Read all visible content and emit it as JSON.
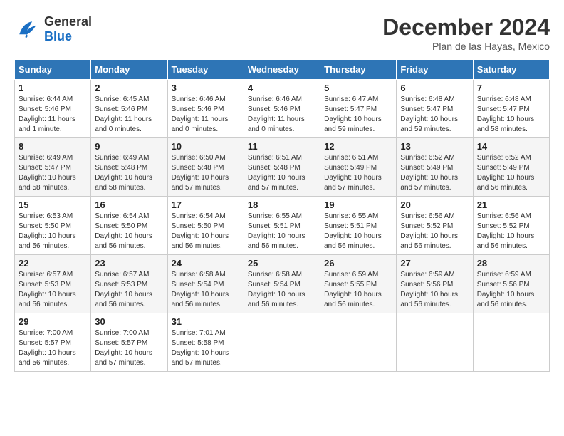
{
  "header": {
    "logo_line1": "General",
    "logo_line2": "Blue",
    "month": "December 2024",
    "location": "Plan de las Hayas, Mexico"
  },
  "calendar": {
    "weekdays": [
      "Sunday",
      "Monday",
      "Tuesday",
      "Wednesday",
      "Thursday",
      "Friday",
      "Saturday"
    ],
    "weeks": [
      [
        null,
        {
          "day": "2",
          "sunrise": "6:45 AM",
          "sunset": "5:46 PM",
          "daylight": "11 hours and 0 minutes."
        },
        {
          "day": "3",
          "sunrise": "6:46 AM",
          "sunset": "5:46 PM",
          "daylight": "11 hours and 0 minutes."
        },
        {
          "day": "4",
          "sunrise": "6:46 AM",
          "sunset": "5:46 PM",
          "daylight": "11 hours and 0 minutes."
        },
        {
          "day": "5",
          "sunrise": "6:47 AM",
          "sunset": "5:47 PM",
          "daylight": "10 hours and 59 minutes."
        },
        {
          "day": "6",
          "sunrise": "6:48 AM",
          "sunset": "5:47 PM",
          "daylight": "10 hours and 59 minutes."
        },
        {
          "day": "7",
          "sunrise": "6:48 AM",
          "sunset": "5:47 PM",
          "daylight": "10 hours and 58 minutes."
        }
      ],
      [
        {
          "day": "1",
          "sunrise": "6:44 AM",
          "sunset": "5:46 PM",
          "daylight": "11 hours and 1 minute."
        },
        {
          "day": "8",
          "sunrise": "6:49 AM",
          "sunset": "5:47 PM",
          "daylight": "10 hours and 58 minutes."
        },
        null,
        null,
        null,
        null,
        null
      ],
      [
        {
          "day": "8",
          "sunrise": "6:49 AM",
          "sunset": "5:47 PM",
          "daylight": "10 hours and 58 minutes."
        },
        {
          "day": "9",
          "sunrise": "6:49 AM",
          "sunset": "5:48 PM",
          "daylight": "10 hours and 58 minutes."
        },
        {
          "day": "10",
          "sunrise": "6:50 AM",
          "sunset": "5:48 PM",
          "daylight": "10 hours and 57 minutes."
        },
        {
          "day": "11",
          "sunrise": "6:51 AM",
          "sunset": "5:48 PM",
          "daylight": "10 hours and 57 minutes."
        },
        {
          "day": "12",
          "sunrise": "6:51 AM",
          "sunset": "5:49 PM",
          "daylight": "10 hours and 57 minutes."
        },
        {
          "day": "13",
          "sunrise": "6:52 AM",
          "sunset": "5:49 PM",
          "daylight": "10 hours and 57 minutes."
        },
        {
          "day": "14",
          "sunrise": "6:52 AM",
          "sunset": "5:49 PM",
          "daylight": "10 hours and 56 minutes."
        }
      ],
      [
        {
          "day": "15",
          "sunrise": "6:53 AM",
          "sunset": "5:50 PM",
          "daylight": "10 hours and 56 minutes."
        },
        {
          "day": "16",
          "sunrise": "6:54 AM",
          "sunset": "5:50 PM",
          "daylight": "10 hours and 56 minutes."
        },
        {
          "day": "17",
          "sunrise": "6:54 AM",
          "sunset": "5:50 PM",
          "daylight": "10 hours and 56 minutes."
        },
        {
          "day": "18",
          "sunrise": "6:55 AM",
          "sunset": "5:51 PM",
          "daylight": "10 hours and 56 minutes."
        },
        {
          "day": "19",
          "sunrise": "6:55 AM",
          "sunset": "5:51 PM",
          "daylight": "10 hours and 56 minutes."
        },
        {
          "day": "20",
          "sunrise": "6:56 AM",
          "sunset": "5:52 PM",
          "daylight": "10 hours and 56 minutes."
        },
        {
          "day": "21",
          "sunrise": "6:56 AM",
          "sunset": "5:52 PM",
          "daylight": "10 hours and 56 minutes."
        }
      ],
      [
        {
          "day": "22",
          "sunrise": "6:57 AM",
          "sunset": "5:53 PM",
          "daylight": "10 hours and 56 minutes."
        },
        {
          "day": "23",
          "sunrise": "6:57 AM",
          "sunset": "5:53 PM",
          "daylight": "10 hours and 56 minutes."
        },
        {
          "day": "24",
          "sunrise": "6:58 AM",
          "sunset": "5:54 PM",
          "daylight": "10 hours and 56 minutes."
        },
        {
          "day": "25",
          "sunrise": "6:58 AM",
          "sunset": "5:54 PM",
          "daylight": "10 hours and 56 minutes."
        },
        {
          "day": "26",
          "sunrise": "6:59 AM",
          "sunset": "5:55 PM",
          "daylight": "10 hours and 56 minutes."
        },
        {
          "day": "27",
          "sunrise": "6:59 AM",
          "sunset": "5:56 PM",
          "daylight": "10 hours and 56 minutes."
        },
        {
          "day": "28",
          "sunrise": "6:59 AM",
          "sunset": "5:56 PM",
          "daylight": "10 hours and 56 minutes."
        }
      ],
      [
        {
          "day": "29",
          "sunrise": "7:00 AM",
          "sunset": "5:57 PM",
          "daylight": "10 hours and 56 minutes."
        },
        {
          "day": "30",
          "sunrise": "7:00 AM",
          "sunset": "5:57 PM",
          "daylight": "10 hours and 57 minutes."
        },
        {
          "day": "31",
          "sunrise": "7:01 AM",
          "sunset": "5:58 PM",
          "daylight": "10 hours and 57 minutes."
        },
        null,
        null,
        null,
        null
      ]
    ]
  }
}
